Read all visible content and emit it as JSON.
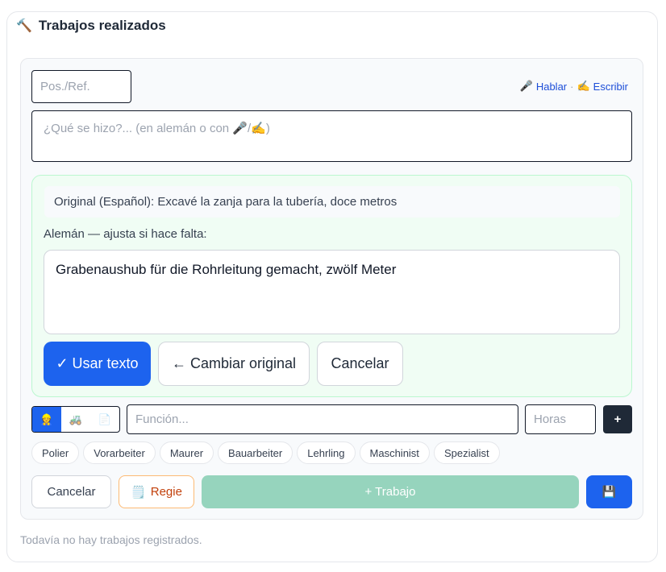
{
  "section": {
    "icon": "hammer-icon",
    "title": "Trabajos realizados"
  },
  "form": {
    "pos_placeholder": "Pos./Ref.",
    "voice": {
      "hablar_icon": "microphone-icon",
      "hablar_label": "Hablar",
      "separator": "·",
      "escribir_icon": "writing-hand-icon",
      "escribir_label": "Escribir"
    },
    "description_placeholder": "¿Qué se hizo?... (en alemán o con 🎤/✍️)"
  },
  "translation": {
    "original_line": "Original (Español): Excavé la zanja para la tubería, doce metros",
    "german_label": "Alemán — ajusta si hace falta:",
    "german_text": "Grabenaushub für die Rohrleitung gemacht, zwölf Meter",
    "use_button": "✓ Usar texto",
    "change_button": "← Cambiar original",
    "cancel_button": "Cancelar"
  },
  "worker": {
    "toggle": [
      {
        "icon": "worker-icon",
        "glyph": "👷",
        "active": true
      },
      {
        "icon": "tractor-icon",
        "glyph": "🚜",
        "active": false
      },
      {
        "icon": "document-icon",
        "glyph": "📄",
        "active": false
      }
    ],
    "funcion_placeholder": "Función...",
    "horas_placeholder": "Horas",
    "add_label": "+"
  },
  "roles": [
    "Polier",
    "Vorarbeiter",
    "Maurer",
    "Bauarbeiter",
    "Lehrling",
    "Maschinist",
    "Spezialist"
  ],
  "actions": {
    "cancel": "Cancelar",
    "regie_icon": "notepad-icon",
    "regie": "Regie",
    "add_trabajo": "+ Trabajo",
    "save_icon": "floppy-disk-icon"
  },
  "empty_message": "Todavía no hay trabajos registrados.",
  "colors": {
    "primary": "#1d63ee",
    "success_bg": "#f0fdf4",
    "success_border": "#bbf7d0",
    "trabajo_button": "#96d4bd",
    "regie_text": "#c2410c",
    "dark_button": "#1f2937"
  }
}
